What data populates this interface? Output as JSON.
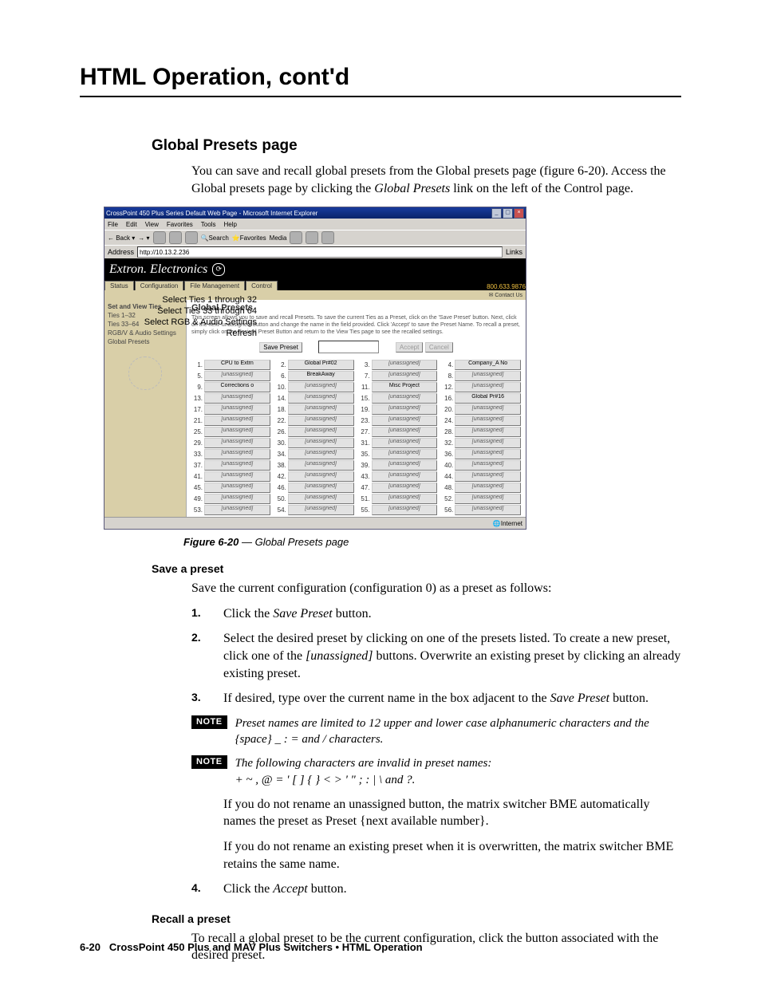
{
  "chapterTitle": "HTML Operation, cont'd",
  "section": {
    "heading": "Global Presets page",
    "intro": "You can save and recall global presets from the Global presets page (figure 6-20). Access the Global presets page by clicking the Global Presets link on the left of the Control page.",
    "figureCaptionBold": "Figure 6-20",
    "figureCaptionRest": " — Global Presets page"
  },
  "callouts": [
    "Select Ties 1 through 32",
    "Select Ties 33 through 64",
    "Select RGB & Audio Settings",
    "Refresh"
  ],
  "ieWindow": {
    "title": "CrossPoint 450 Plus Series Default Web Page - Microsoft Internet Explorer",
    "menus": [
      "File",
      "Edit",
      "View",
      "Favorites",
      "Tools",
      "Help"
    ],
    "toolbarItems": [
      "Back",
      "",
      "",
      "",
      "",
      "Search",
      "Favorites",
      "Media",
      "",
      "",
      "",
      ""
    ],
    "addressLabel": "Address",
    "addressValue": "http://10.13.2.236",
    "linksLabel": "Links",
    "brand": "Extron. Electronics",
    "tabs": [
      "Status",
      "Configuration",
      "File Management",
      "Control"
    ],
    "phone": "800.633.9876",
    "contact": "Contact Us",
    "sidenav": {
      "header": "Set and View Ties",
      "items": [
        "Ties 1–32",
        "Ties 33–64",
        "RGB/V & Audio Settings",
        "Global Presets"
      ]
    },
    "pane": {
      "title": "Global Presets",
      "desc": "This screen allows you to save and recall Presets. To save the current Ties as a Preset, click on the 'Save Preset' button. Next, click on the next 'unassigned' button and change the name in the field provided. Click 'Accept' to save the Preset Name. To recall a preset, simply click on the desired Preset Button and return to the View Ties page to see the recalled settings.",
      "saveBtn": "Save Preset",
      "acceptBtn": "Accept",
      "cancelBtn": "Cancel"
    },
    "presets": [
      {
        "n": 1,
        "l": "CPU to Extrn",
        "named": true
      },
      {
        "n": 2,
        "l": "Global Pr#02",
        "named": true
      },
      {
        "n": 3,
        "l": "[unassigned]"
      },
      {
        "n": 4,
        "l": "Company_A No",
        "named": true
      },
      {
        "n": 5,
        "l": "[unassigned]"
      },
      {
        "n": 6,
        "l": "BreakAway",
        "named": true
      },
      {
        "n": 7,
        "l": "[unassigned]"
      },
      {
        "n": 8,
        "l": "[unassigned]"
      },
      {
        "n": 9,
        "l": "Corrections o",
        "named": true
      },
      {
        "n": 10,
        "l": "[unassigned]"
      },
      {
        "n": 11,
        "l": "Misc Project",
        "named": true
      },
      {
        "n": 12,
        "l": "[unassigned]"
      },
      {
        "n": 13,
        "l": "[unassigned]"
      },
      {
        "n": 14,
        "l": "[unassigned]"
      },
      {
        "n": 15,
        "l": "[unassigned]"
      },
      {
        "n": 16,
        "l": "Global Pr#16",
        "named": true
      },
      {
        "n": 17,
        "l": "[unassigned]"
      },
      {
        "n": 18,
        "l": "[unassigned]"
      },
      {
        "n": 19,
        "l": "[unassigned]"
      },
      {
        "n": 20,
        "l": "[unassigned]"
      },
      {
        "n": 21,
        "l": "[unassigned]"
      },
      {
        "n": 22,
        "l": "[unassigned]"
      },
      {
        "n": 23,
        "l": "[unassigned]"
      },
      {
        "n": 24,
        "l": "[unassigned]"
      },
      {
        "n": 25,
        "l": "[unassigned]"
      },
      {
        "n": 26,
        "l": "[unassigned]"
      },
      {
        "n": 27,
        "l": "[unassigned]"
      },
      {
        "n": 28,
        "l": "[unassigned]"
      },
      {
        "n": 29,
        "l": "[unassigned]"
      },
      {
        "n": 30,
        "l": "[unassigned]"
      },
      {
        "n": 31,
        "l": "[unassigned]"
      },
      {
        "n": 32,
        "l": "[unassigned]"
      },
      {
        "n": 33,
        "l": "[unassigned]"
      },
      {
        "n": 34,
        "l": "[unassigned]"
      },
      {
        "n": 35,
        "l": "[unassigned]"
      },
      {
        "n": 36,
        "l": "[unassigned]"
      },
      {
        "n": 37,
        "l": "[unassigned]"
      },
      {
        "n": 38,
        "l": "[unassigned]"
      },
      {
        "n": 39,
        "l": "[unassigned]"
      },
      {
        "n": 40,
        "l": "[unassigned]"
      },
      {
        "n": 41,
        "l": "[unassigned]"
      },
      {
        "n": 42,
        "l": "[unassigned]"
      },
      {
        "n": 43,
        "l": "[unassigned]"
      },
      {
        "n": 44,
        "l": "[unassigned]"
      },
      {
        "n": 45,
        "l": "[unassigned]"
      },
      {
        "n": 46,
        "l": "[unassigned]"
      },
      {
        "n": 47,
        "l": "[unassigned]"
      },
      {
        "n": 48,
        "l": "[unassigned]"
      },
      {
        "n": 49,
        "l": "[unassigned]"
      },
      {
        "n": 50,
        "l": "[unassigned]"
      },
      {
        "n": 51,
        "l": "[unassigned]"
      },
      {
        "n": 52,
        "l": "[unassigned]"
      },
      {
        "n": 53,
        "l": "[unassigned]"
      },
      {
        "n": 54,
        "l": "[unassigned]"
      },
      {
        "n": 55,
        "l": "[unassigned]"
      },
      {
        "n": 56,
        "l": "[unassigned]"
      }
    ],
    "statusText": "Internet"
  },
  "save": {
    "heading": "Save a preset",
    "lead": "Save the current configuration (configuration 0) as a preset as follows:",
    "steps": [
      "Click the <span class='italic'>Save Preset</span> button.",
      "Select the desired preset by clicking on one of the presets listed.  To create a new preset, click one of the <span class='italic'>[unassigned]</span> buttons.  Overwrite an existing preset by clicking an already existing preset.",
      "If desired, type over the current name in the box adjacent to the <span class='italic'>Save Preset</span> button.",
      "Click the <span class='italic'>Accept</span> button."
    ],
    "note1": "Preset names are limited to 12 upper and lower case alphanumeric characters and the {space}  _  :  =  and  /  characters.",
    "note2a": "The following characters are invalid in preset names:",
    "note2b": "+  ~  ,  @  =  '  [  ]  {  }  <  >  '  \"  ;  :  |  \\  and ?.",
    "after3_a": "If you do not rename an unassigned button, the matrix switcher BME automatically names the preset as Preset {next available number}.",
    "after3_b": "If you do not rename an existing preset when it is overwritten, the matrix switcher BME retains the same name."
  },
  "recall": {
    "heading": "Recall a preset",
    "text": "To recall a global preset to be the current configuration, click the button associated with the desired preset."
  },
  "footer": {
    "pageNum": "6-20",
    "text": "CrossPoint 450 Plus and MAV Plus Switchers • HTML Operation"
  }
}
